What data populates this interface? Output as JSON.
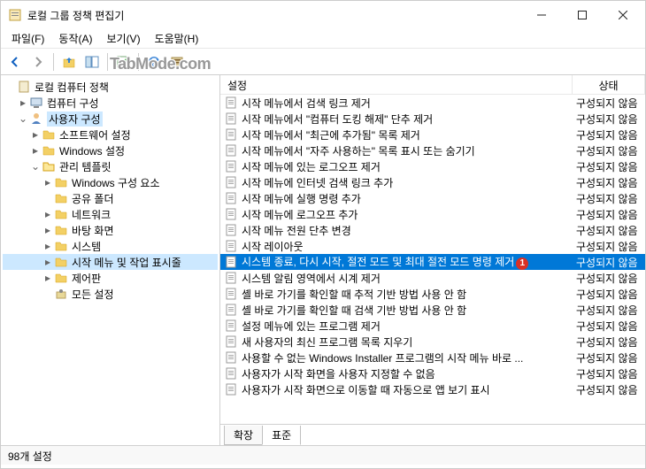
{
  "window": {
    "title": "로컬 그룹 정책 편집기"
  },
  "menu": {
    "file": "파일(F)",
    "action": "동작(A)",
    "view": "보기(V)",
    "help": "도움말(H)"
  },
  "tree": {
    "root": "로컬 컴퓨터 정책",
    "computer": "컴퓨터 구성",
    "user": "사용자 구성",
    "software": "소프트웨어 설정",
    "windows_settings": "Windows 설정",
    "admin_templates": "관리 템플릿",
    "windows_components": "Windows 구성 요소",
    "shared_folder": "공유 폴더",
    "network": "네트워크",
    "desktop": "바탕 화면",
    "system": "시스템",
    "start_menu": "시작 메뉴 및 작업 표시줄",
    "control_panel": "제어판",
    "all_settings": "모든 설정"
  },
  "columns": {
    "setting": "설정",
    "state": "상태"
  },
  "state_not_configured": "구성되지 않음",
  "items": [
    {
      "name": "시작 메뉴에서 검색 링크 제거"
    },
    {
      "name": "시작 메뉴에서 \"컴퓨터 도킹 해제\" 단추 제거"
    },
    {
      "name": "시작 메뉴에서 \"최근에 추가됨\" 목록 제거"
    },
    {
      "name": "시작 메뉴에서 \"자주 사용하는\" 목록 표시 또는 숨기기"
    },
    {
      "name": "시작 메뉴에 있는 로그오프 제거"
    },
    {
      "name": "시작 메뉴에 인터넷 검색 링크 추가"
    },
    {
      "name": "시작 메뉴에 실행 명령 추가"
    },
    {
      "name": "시작 메뉴에 로그오프 추가"
    },
    {
      "name": "시작 메뉴 전원 단추 변경"
    },
    {
      "name": "시작 레이아웃"
    },
    {
      "name": "시스템 종료, 다시 시작, 절전 모드 및 최대 절전 모드 명령 제거",
      "selected": true,
      "badge": "1"
    },
    {
      "name": "시스템 알림 영역에서 시계 제거"
    },
    {
      "name": "셸 바로 가기를 확인할 때 추적 기반 방법 사용 안 함"
    },
    {
      "name": "셸 바로 가기를 확인할 때 검색 기반 방법 사용 안 함"
    },
    {
      "name": "설정 메뉴에 있는 프로그램 제거"
    },
    {
      "name": "새 사용자의 최신 프로그램 목록 지우기"
    },
    {
      "name": "사용할 수 없는 Windows Installer 프로그램의 시작 메뉴 바로 ..."
    },
    {
      "name": "사용자가 시작 화면을 사용자 지정할 수 없음"
    },
    {
      "name": "사용자가 시작 화면으로 이동할 때 자동으로 앱 보기 표시"
    }
  ],
  "tabs": {
    "expand": "확장",
    "standard": "표준"
  },
  "status": "98개 설정",
  "watermark": "TabMode.com"
}
